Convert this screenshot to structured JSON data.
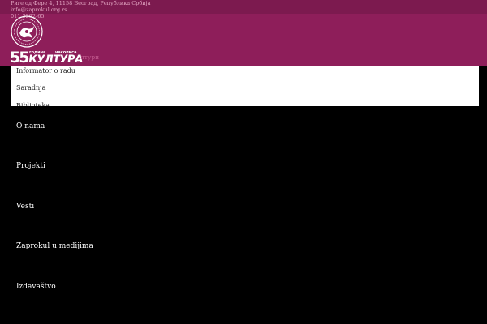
{
  "contact": {
    "address": "Риге од Фере 4, 11158 Београд, Република Србија",
    "email": "info@zaprokul.org.rs",
    "phone": "011 3292-65"
  },
  "logo": {
    "number": "55",
    "sub1": "година",
    "sub2": "часописа",
    "title": "КУЛТУРА",
    "tail": "лтури"
  },
  "dropdown": {
    "items": [
      "Informator o radu",
      "Saradnja",
      "Biblioteka"
    ]
  },
  "nav": {
    "items": [
      "O nama",
      "Projekti",
      "Vesti",
      "Zaprokul u medijima",
      "Izdavaštvo"
    ]
  },
  "colors": {
    "header": "#8e1e5a",
    "topbar": "#7c1a4f",
    "background": "#000000"
  }
}
